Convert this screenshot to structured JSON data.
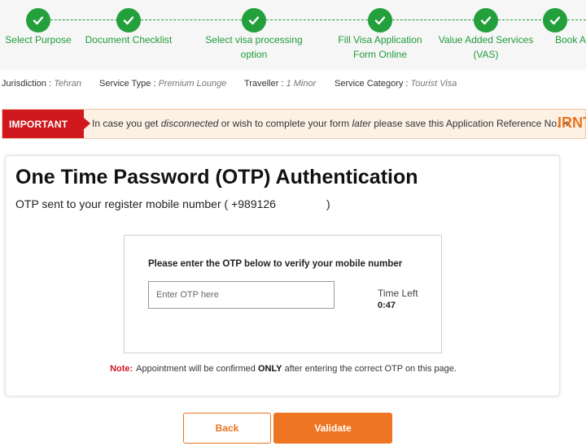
{
  "steps": [
    {
      "label_1": "Select Purpose",
      "label_2": ""
    },
    {
      "label_1": "Document Checklist",
      "label_2": ""
    },
    {
      "label_1": "Select visa processing option",
      "label_2": ""
    },
    {
      "label_1": "Fill Visa Application",
      "label_2": "Form Online"
    },
    {
      "label_1": "Value Added Services",
      "label_2": "(VAS)"
    },
    {
      "label_1": "Book Ap",
      "label_2": ""
    }
  ],
  "info": {
    "jurisdiction_label": "Jurisdiction :",
    "jurisdiction_value": "Tehran",
    "service_type_label": "Service Type :",
    "service_type_value": "Premium Lounge",
    "traveller_label": "Traveller :",
    "traveller_value": "1 Minor",
    "service_category_label": "Service Category :",
    "service_category_value": "Tourist Visa"
  },
  "banner": {
    "tag": "IMPORTANT",
    "text_1": "In case you get ",
    "text_em1": "disconnected",
    "text_2": " or wish to complete your form ",
    "text_em2": "later",
    "text_3": " please save this Application Reference No. ",
    "arrow": "➔",
    "reference": "IRNT"
  },
  "main": {
    "title": "One Time Password (OTP) Authentication",
    "subtitle_prefix": "OTP sent to your register mobile number ( +989126",
    "subtitle_suffix": ")",
    "otp_prompt": "Please enter the OTP below to verify your mobile number",
    "otp_placeholder": "Enter OTP here",
    "time_left_label": "Time Left",
    "time_left_value": "0:47",
    "note_label": "Note:",
    "note_text_1": "Appointment will be confirmed ",
    "note_bold": "ONLY",
    "note_text_2": " after entering the correct OTP on this page."
  },
  "buttons": {
    "back": "Back",
    "validate": "Validate"
  },
  "colors": {
    "step_green": "#23a03c",
    "important_red": "#d0191f",
    "accent_orange": "#ee7522"
  }
}
